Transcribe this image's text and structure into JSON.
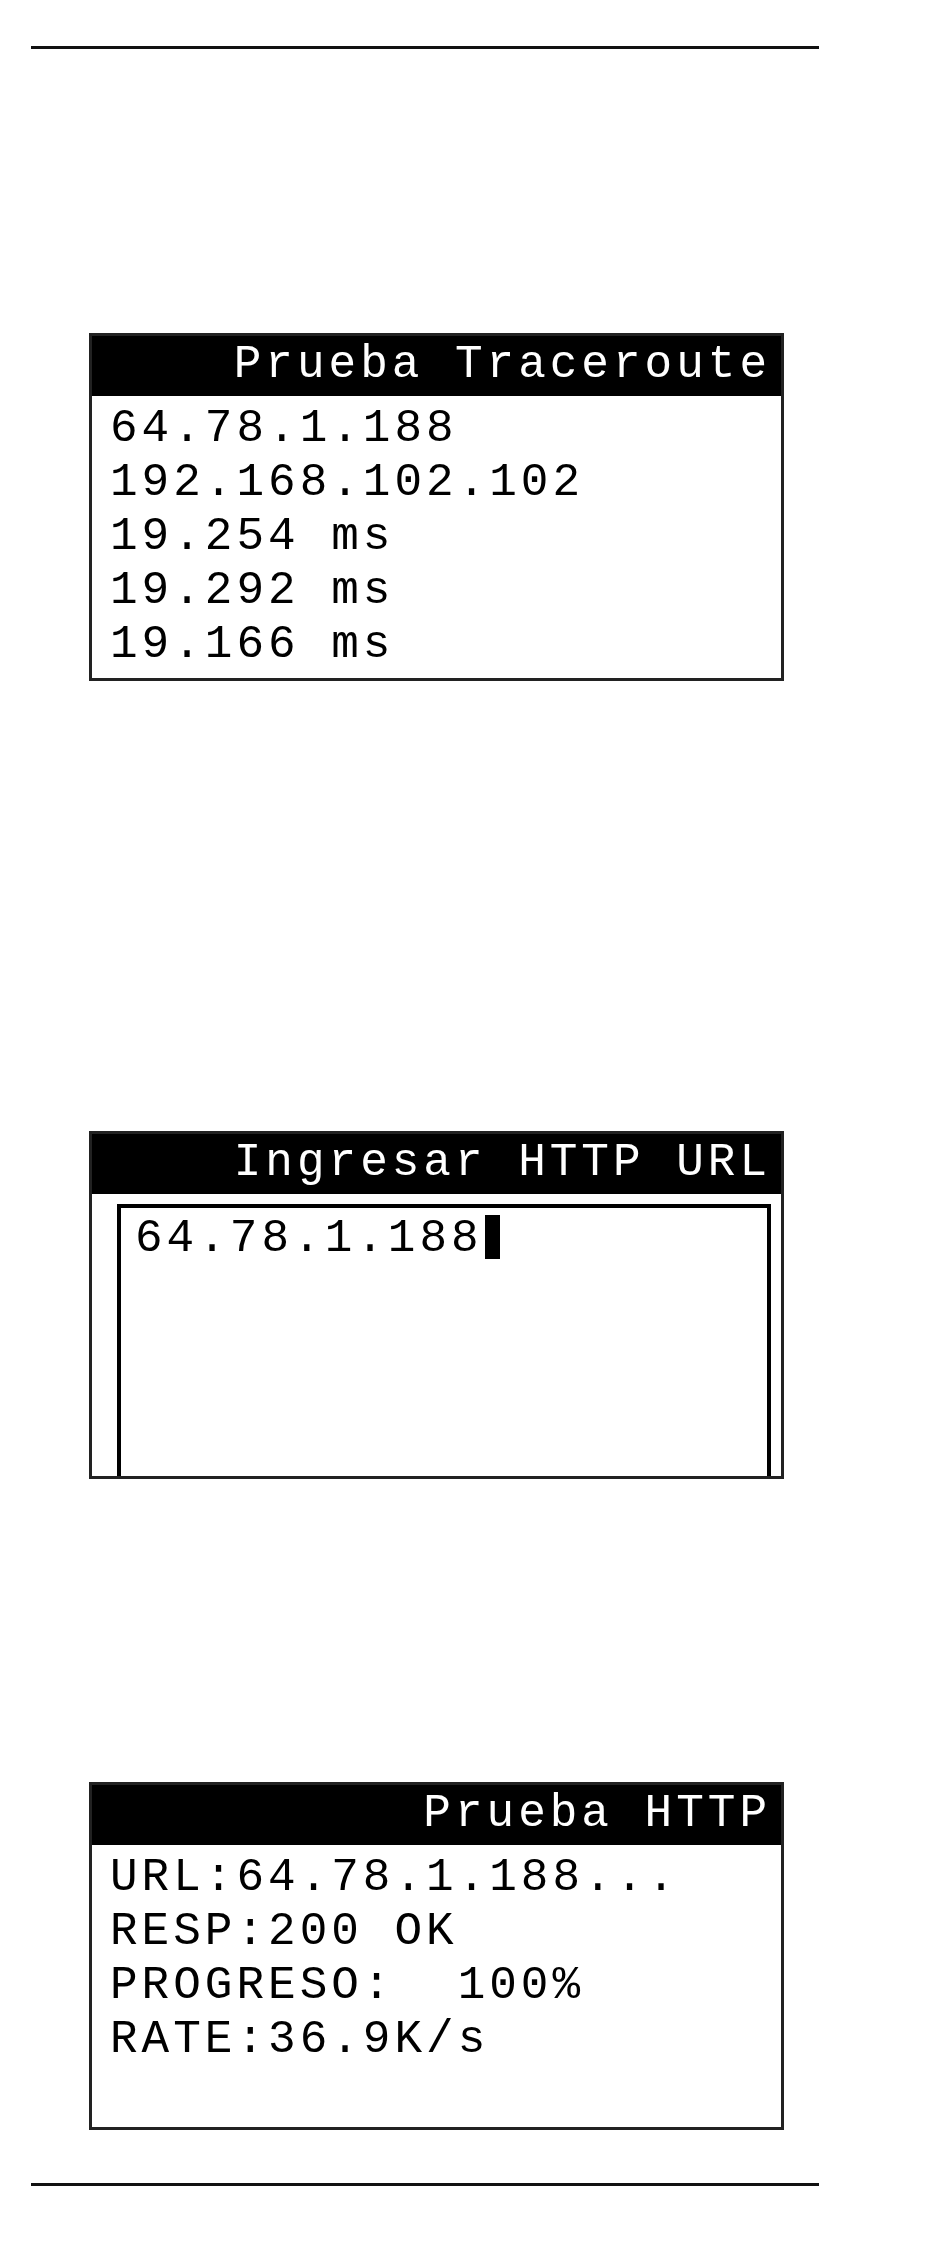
{
  "screens": [
    {
      "kind": "results",
      "title": "Prueba Traceroute",
      "lines": [
        "64.78.1.188",
        "192.168.102.102",
        "19.254 ms",
        "19.292 ms",
        "19.166 ms"
      ]
    },
    {
      "kind": "input",
      "title": "Ingresar HTTP URL",
      "field": {
        "value": "64.78.1.188",
        "cursor": true
      }
    },
    {
      "kind": "results",
      "title": "Prueba HTTP",
      "lines": [
        "URL:64.78.1.188...",
        "RESP:200 OK",
        "PROGRESO:  100%",
        "RATE:36.9K/s"
      ]
    }
  ]
}
